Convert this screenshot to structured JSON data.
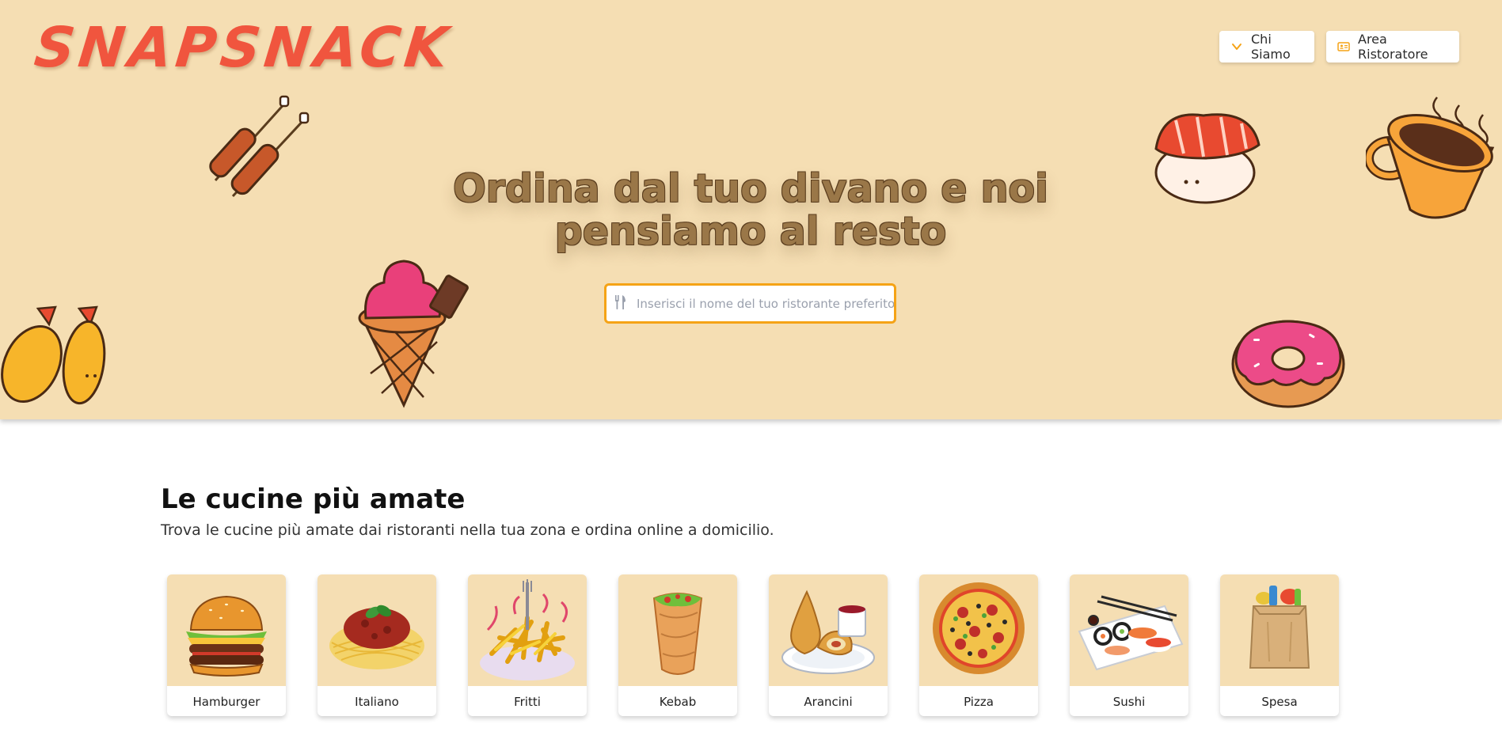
{
  "brand": {
    "logo": "SNAPSNACK"
  },
  "nav": {
    "chi_siamo": {
      "label": "Chi Siamo",
      "icon": "chevron-down-icon"
    },
    "area_ristoratore": {
      "label": "Area Ristoratore",
      "icon": "id-card-icon"
    }
  },
  "hero": {
    "headline_line1": "Ordina dal tuo divano e noi",
    "headline_line2": "pensiamo al resto",
    "search": {
      "placeholder": "Inserisci il nome del tuo ristorante preferito",
      "value": "",
      "icon": "utensils-icon"
    }
  },
  "section": {
    "title": "Le cucine più amate",
    "subtitle": "Trova le cucine più amate dai ristoranti nella tua zona e ordina online a domicilio."
  },
  "cuisines": [
    {
      "label": "Hamburger",
      "icon": "hamburger-icon"
    },
    {
      "label": "Italiano",
      "icon": "spaghetti-icon"
    },
    {
      "label": "Fritti",
      "icon": "fries-icon"
    },
    {
      "label": "Kebab",
      "icon": "kebab-wrap-icon"
    },
    {
      "label": "Arancini",
      "icon": "arancini-icon"
    },
    {
      "label": "Pizza",
      "icon": "pizza-icon"
    },
    {
      "label": "Sushi",
      "icon": "sushi-icon"
    },
    {
      "label": "Spesa",
      "icon": "grocery-bag-icon"
    }
  ],
  "colors": {
    "hero_background": "#f5deb3",
    "logo": "#f0553e",
    "search_border": "#f5a316",
    "nav_icon": "#f5a316",
    "headline": "#9a7748"
  }
}
